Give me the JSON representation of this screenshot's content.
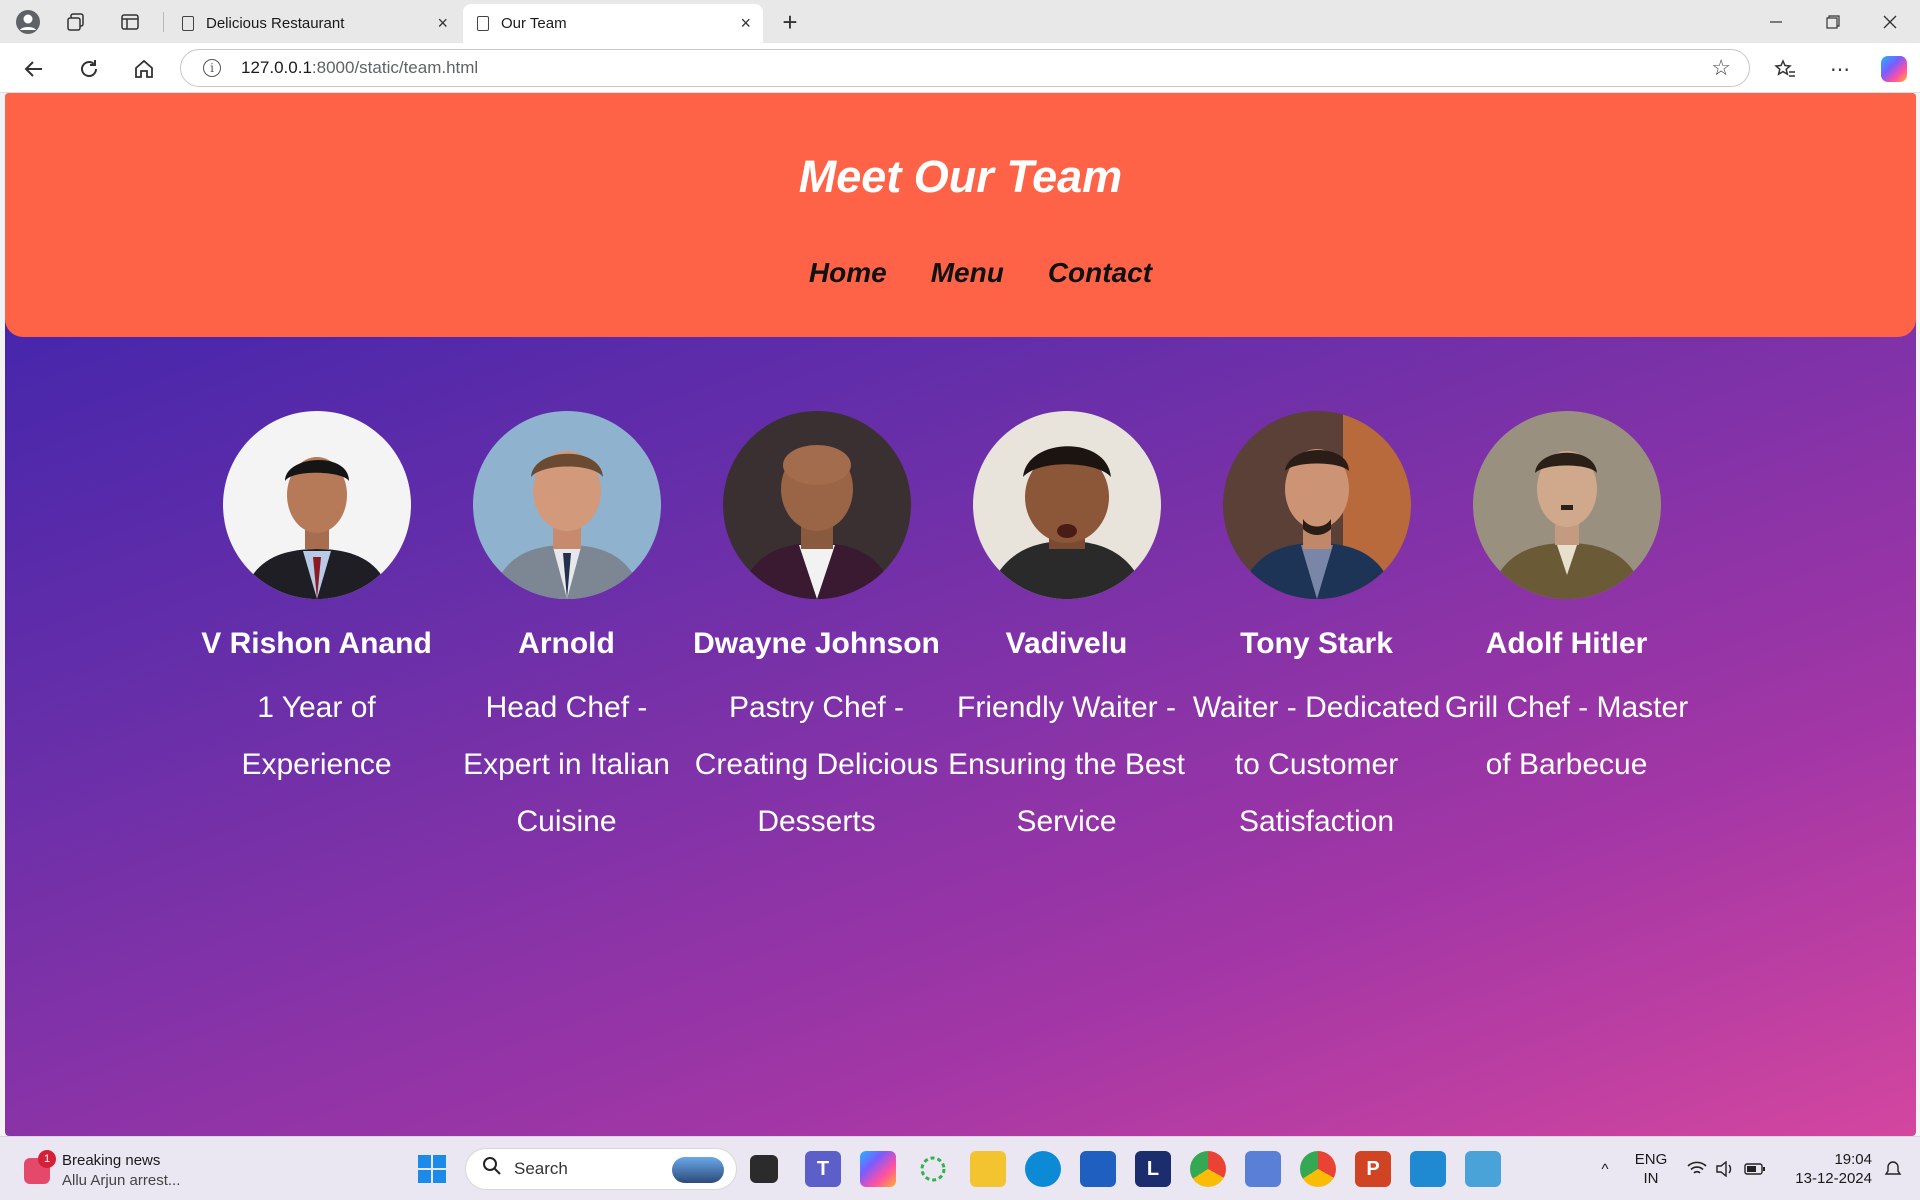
{
  "browser": {
    "tabs": [
      {
        "label": "Delicious Restaurant",
        "close": "×"
      },
      {
        "label": "Our Team",
        "close": "×"
      }
    ],
    "new_tab": "+",
    "url_host": "127.0.0.1",
    "url_rest": ":8000/static/team.html"
  },
  "site": {
    "title": "Meet Our Team",
    "nav": [
      "Home",
      "Menu",
      "Contact"
    ]
  },
  "team": [
    {
      "name": "V Rishon Anand",
      "role": "1 Year of Experience"
    },
    {
      "name": "Arnold",
      "role": "Head Chef - Expert in Italian Cuisine"
    },
    {
      "name": "Dwayne Johnson",
      "role": "Pastry Chef - Creating Delicious Desserts"
    },
    {
      "name": "Vadivelu",
      "role": "Friendly Waiter - Ensuring the Best Service"
    },
    {
      "name": "Tony Stark",
      "role": "Waiter - Dedicated to Customer Satisfaction"
    },
    {
      "name": "Adolf Hitler",
      "role": "Grill Chef - Master of Barbecue"
    }
  ],
  "taskbar": {
    "news_badge": "1",
    "news_title": "Breaking news",
    "news_sub": "Allu Arjun arrest...",
    "search": "Search",
    "lang_1": "ENG",
    "lang_2": "IN",
    "time": "19:04",
    "date": "13-12-2024"
  },
  "colors": {
    "header": "#ff6347",
    "gradient_start": "#3422ad",
    "gradient_end": "#d3469f"
  }
}
